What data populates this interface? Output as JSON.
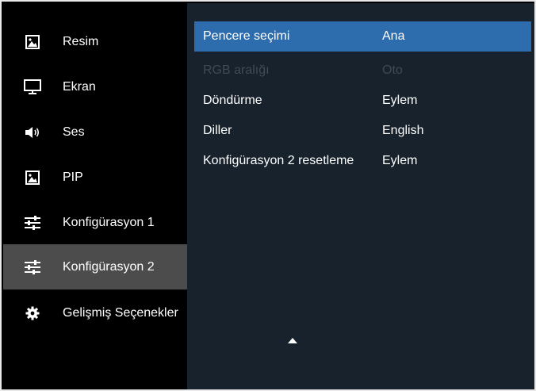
{
  "sidebar": {
    "items": [
      {
        "label": "Resim",
        "icon": "picture-icon"
      },
      {
        "label": "Ekran",
        "icon": "monitor-icon"
      },
      {
        "label": "Ses",
        "icon": "speaker-icon"
      },
      {
        "label": "PIP",
        "icon": "pip-picture-icon"
      },
      {
        "label": "Konfigürasyon 1",
        "icon": "sliders-icon"
      },
      {
        "label": "Konfigürasyon 2",
        "icon": "sliders-icon"
      },
      {
        "label": "Gelişmiş Seçenekler",
        "icon": "gear-icon"
      }
    ],
    "active_index": 5
  },
  "settings": {
    "rows": [
      {
        "label": "Pencere seçimi",
        "value": "Ana",
        "state": "selected"
      },
      {
        "label": "RGB aralığı",
        "value": "Oto",
        "state": "disabled"
      },
      {
        "label": "Döndürme",
        "value": "Eylem",
        "state": "normal"
      },
      {
        "label": "Diller",
        "value": "English",
        "state": "normal"
      },
      {
        "label": "Konfigürasyon 2 resetleme",
        "value": "Eylem",
        "state": "normal"
      }
    ]
  },
  "scroll": {
    "icon": "scroll-up-arrow-icon"
  },
  "colors": {
    "sidebar_bg": "#000000",
    "sidebar_active": "#4c4c4c",
    "panel_bg": "#17222c",
    "selected_row": "#2e6dad",
    "disabled_text": "#3f4a55",
    "text": "#ffffff"
  }
}
